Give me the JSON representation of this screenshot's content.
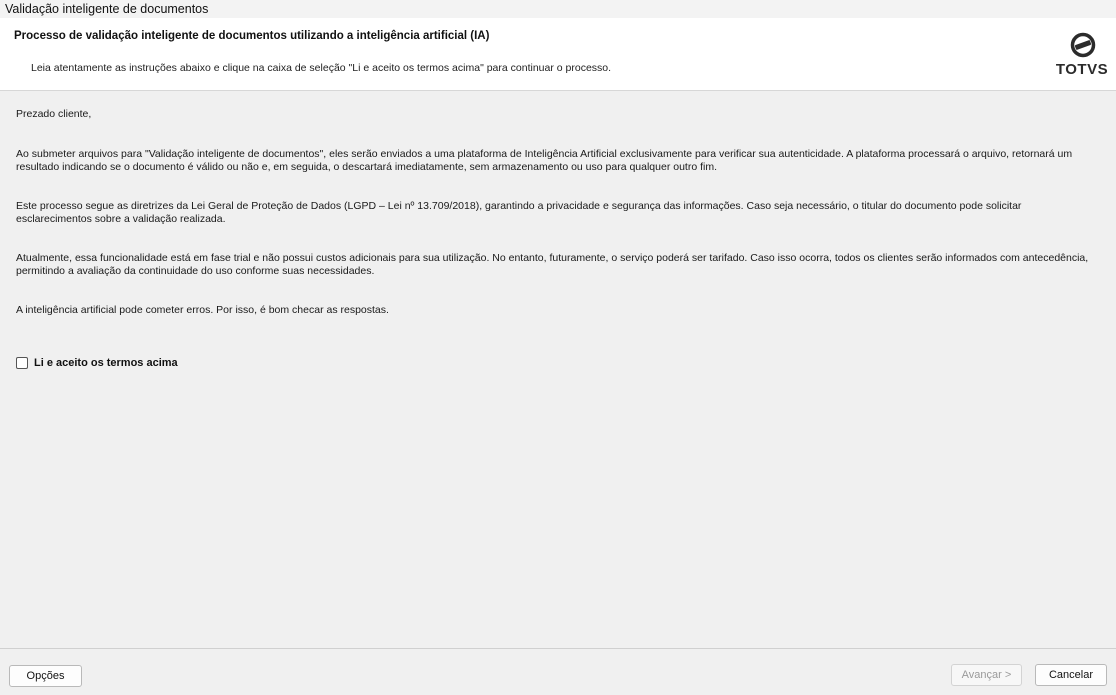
{
  "window": {
    "title": "Validação inteligente de documentos"
  },
  "header": {
    "title": "Processo de validação inteligente de documentos utilizando a inteligência artificial (IA)",
    "subtitle": "Leia atentamente as instruções abaixo e clique na caixa de seleção \"Li e aceito os termos acima\" para continuar o processo.",
    "logo_text": "TOTVS"
  },
  "content": {
    "greeting": "Prezado cliente,",
    "paragraphs": [
      "Ao submeter arquivos para \"Validação inteligente de documentos\", eles serão enviados a uma plataforma de Inteligência Artificial exclusivamente para verificar sua autenticidade. A plataforma processará o arquivo, retornará um resultado indicando se o documento é válido ou não e, em seguida, o descartará imediatamente, sem armazenamento ou uso para qualquer outro fim.",
      "Este processo segue as diretrizes da Lei Geral de Proteção de Dados (LGPD – Lei nº 13.709/2018), garantindo a privacidade e segurança das informações. Caso seja necessário, o titular do documento pode solicitar esclarecimentos sobre a validação realizada.",
      "Atualmente, essa funcionalidade está em fase trial e não possui custos adicionais para sua utilização. No entanto, futuramente, o serviço poderá ser tarifado. Caso isso ocorra, todos os clientes serão informados com antecedência, permitindo a avaliação da continuidade do uso conforme suas necessidades.",
      "A inteligência artificial pode cometer erros. Por isso, é bom checar as respostas."
    ],
    "accept_label": "Li e aceito os termos acima",
    "accept_checked": false
  },
  "footer": {
    "options_label": "Opções",
    "next_label": "Avançar >",
    "cancel_label": "Cancelar"
  }
}
